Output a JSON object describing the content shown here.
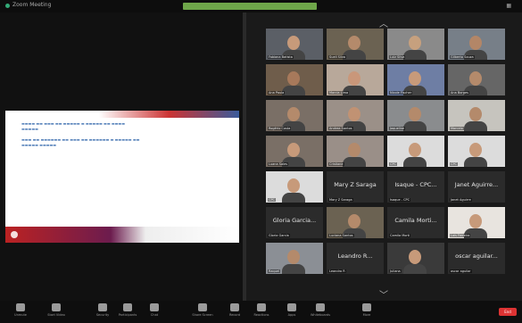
{
  "window": {
    "title": "Zoom Meeting"
  },
  "gallery": {
    "tiles": [
      {
        "name": "Fabiana Batista",
        "bg": "#5b5f66",
        "skin": "#c79a7a"
      },
      {
        "name": "Sueli Silva",
        "bg": "#6b6252",
        "skin": "#b48a6b"
      },
      {
        "name": "Luiz Silva",
        "bg": "#8a8a8a",
        "skin": "#c6a07e"
      },
      {
        "name": "Gilberto Souza",
        "bg": "#777f88",
        "skin": "#b38667"
      },
      {
        "name": "Ana Paula",
        "bg": "#6f5d4b",
        "skin": "#a7795b"
      },
      {
        "name": "Marcia Lima",
        "bg": "#b8a89a",
        "skin": "#c9977a"
      },
      {
        "name": "Nicole Fischer",
        "bg": "#6e7ea4",
        "skin": "#c79a7a"
      },
      {
        "name": "Ana Borges",
        "bg": "#666",
        "skin": "#b48a6b"
      },
      {
        "name": "Rogério Costa",
        "bg": "#7a6f66",
        "skin": "#b48a6b"
      },
      {
        "name": "Andrea Santos",
        "bg": "#9b9088",
        "skin": "#c19273"
      },
      {
        "name": "Jaqueline",
        "bg": "#8a8c8e",
        "skin": "#b48a6b"
      },
      {
        "name": "Marcelo",
        "bg": "#c6c4be",
        "skin": "#b48a6b"
      },
      {
        "name": "Luana Sales",
        "bg": "#7a6f66",
        "skin": "#c79a7a"
      },
      {
        "name": "Cristiane",
        "bg": "#9a8f88",
        "skin": "#b48a6b"
      },
      {
        "name": "CPC",
        "bg": "#dcdcdc",
        "skin": "#c79a7a"
      },
      {
        "name": "CPC",
        "bg": "#dcdcdc",
        "skin": "#c79a7a"
      },
      {
        "name": "CPC",
        "bg": "#dcdcdc",
        "skin": "#c79a7a"
      },
      {
        "label": "Mary Z Saraga",
        "name": "Mary Z Saraga"
      },
      {
        "label": "Isaque - CPC...",
        "name": "Isaque - CPC"
      },
      {
        "label": "Janet Aguirre...",
        "name": "Janet Aguirre"
      },
      {
        "label": "Gloria Garcia...",
        "name": "Gloria Garcia"
      },
      {
        "name": "Luciana Santos",
        "bg": "#6b6252",
        "skin": "#b48a6b"
      },
      {
        "label": "Camila Morti...",
        "name": "Camila Morti"
      },
      {
        "name": "Lais Ferreira",
        "bg": "#e8e4df",
        "skin": "#c79a7a"
      },
      {
        "name": "Raquel",
        "bg": "#8b8f95",
        "skin": "#b48a6b"
      },
      {
        "label": "Leandro R...",
        "name": "Leandro R"
      },
      {
        "name": "Juliana",
        "bg": "#3a3a3a",
        "skin": "#c79a7a"
      },
      {
        "label": "oscar aguilar...",
        "name": "oscar aguilar"
      }
    ]
  },
  "toolbar": {
    "items": [
      {
        "label": "Unmute"
      },
      {
        "label": "Start Video"
      },
      {
        "label": "Security"
      },
      {
        "label": "Participants"
      },
      {
        "label": "Chat"
      },
      {
        "label": "Share Screen"
      },
      {
        "label": "Record"
      },
      {
        "label": "Reactions"
      },
      {
        "label": "Apps"
      },
      {
        "label": "Whiteboards"
      },
      {
        "label": "More"
      }
    ],
    "end_label": "End"
  }
}
